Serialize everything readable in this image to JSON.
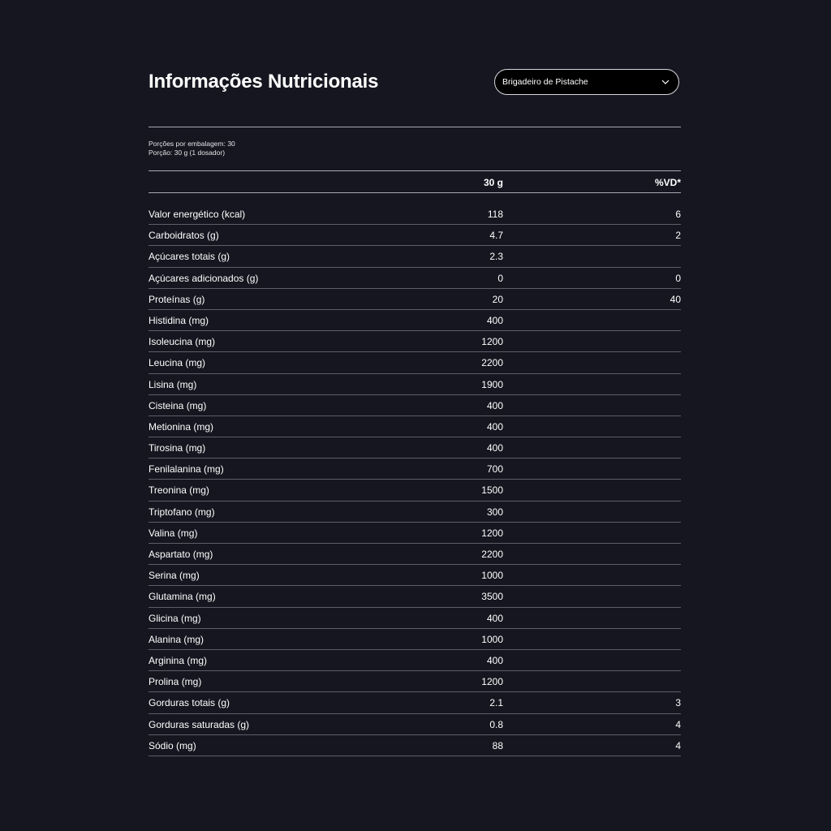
{
  "title": "Informações Nutricionais",
  "flavor_select": {
    "selected": "Brigadeiro de Pistache"
  },
  "serving": {
    "per_package": "Porções por embalagem: 30",
    "portion": "Porção: 30 g (1 dosador)"
  },
  "table": {
    "headers": {
      "amount": "30 g",
      "dv": "%VD*"
    },
    "rows": [
      {
        "name": "Valor energético (kcal)",
        "amount": "118",
        "dv": "6"
      },
      {
        "name": "Carboidratos (g)",
        "amount": "4.7",
        "dv": "2"
      },
      {
        "name": "Açúcares totais (g)",
        "amount": "2.3",
        "dv": ""
      },
      {
        "name": "Açúcares adicionados (g)",
        "amount": "0",
        "dv": "0"
      },
      {
        "name": "Proteínas (g)",
        "amount": "20",
        "dv": "40"
      },
      {
        "name": "Histidina (mg)",
        "amount": "400",
        "dv": ""
      },
      {
        "name": "Isoleucina (mg)",
        "amount": "1200",
        "dv": ""
      },
      {
        "name": "Leucina (mg)",
        "amount": "2200",
        "dv": ""
      },
      {
        "name": "Lisina (mg)",
        "amount": "1900",
        "dv": ""
      },
      {
        "name": "Cisteina (mg)",
        "amount": "400",
        "dv": ""
      },
      {
        "name": "Metionina (mg)",
        "amount": "400",
        "dv": ""
      },
      {
        "name": "Tirosina (mg)",
        "amount": "400",
        "dv": ""
      },
      {
        "name": "Fenilalanina (mg)",
        "amount": "700",
        "dv": ""
      },
      {
        "name": "Treonina (mg)",
        "amount": "1500",
        "dv": ""
      },
      {
        "name": "Triptofano (mg)",
        "amount": "300",
        "dv": ""
      },
      {
        "name": "Valina (mg)",
        "amount": "1200",
        "dv": ""
      },
      {
        "name": "Aspartato (mg)",
        "amount": "2200",
        "dv": ""
      },
      {
        "name": "Serina (mg)",
        "amount": "1000",
        "dv": ""
      },
      {
        "name": "Glutamina (mg)",
        "amount": "3500",
        "dv": ""
      },
      {
        "name": "Glicina (mg)",
        "amount": "400",
        "dv": ""
      },
      {
        "name": "Alanina (mg)",
        "amount": "1000",
        "dv": ""
      },
      {
        "name": "Arginina (mg)",
        "amount": "400",
        "dv": ""
      },
      {
        "name": "Prolina (mg)",
        "amount": "1200",
        "dv": ""
      },
      {
        "name": "Gorduras totais (g)",
        "amount": "2.1",
        "dv": "3"
      },
      {
        "name": "Gorduras saturadas (g)",
        "amount": "0.8",
        "dv": "4"
      },
      {
        "name": "Sódio (mg)",
        "amount": "88",
        "dv": "4"
      }
    ]
  },
  "colors": {
    "background": "#161620",
    "text": "#ffffff",
    "divider": "#a9a9b2",
    "row_rule": "#5e5e68"
  },
  "icons": {
    "select_chevron": "chevron-down-icon"
  }
}
